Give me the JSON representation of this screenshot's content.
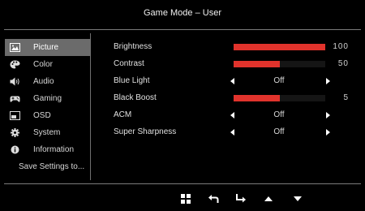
{
  "header": {
    "title": "Game Mode – User"
  },
  "sidebar": {
    "items": [
      {
        "label": "Picture",
        "icon": "picture-icon",
        "selected": true
      },
      {
        "label": "Color",
        "icon": "palette-icon",
        "selected": false
      },
      {
        "label": "Audio",
        "icon": "speaker-icon",
        "selected": false
      },
      {
        "label": "Gaming",
        "icon": "gamepad-icon",
        "selected": false
      },
      {
        "label": "OSD",
        "icon": "osd-icon",
        "selected": false
      },
      {
        "label": "System",
        "icon": "gear-icon",
        "selected": false
      },
      {
        "label": "Information",
        "icon": "info-icon",
        "selected": false
      }
    ],
    "save_label": "Save Settings to..."
  },
  "settings": {
    "brightness": {
      "label": "Brightness",
      "value": "100",
      "level": 1.0
    },
    "contrast": {
      "label": "Contrast",
      "value": "50",
      "level": 0.5
    },
    "blue_light": {
      "label": "Blue Light",
      "value": "Off"
    },
    "black_boost": {
      "label": "Black Boost",
      "value": "5",
      "level": 0.5
    },
    "acm": {
      "label": "ACM",
      "value": "Off"
    },
    "super_sharpness": {
      "label": "Super Sharpness",
      "value": "Off"
    }
  },
  "nav": {
    "buttons": [
      "menu-grid-icon",
      "back-icon",
      "enter-icon",
      "up-arrow-icon",
      "down-arrow-icon"
    ]
  },
  "colors": {
    "accent": "#e1332c",
    "selected_bg": "#6b6b6b",
    "background": "#000000"
  }
}
